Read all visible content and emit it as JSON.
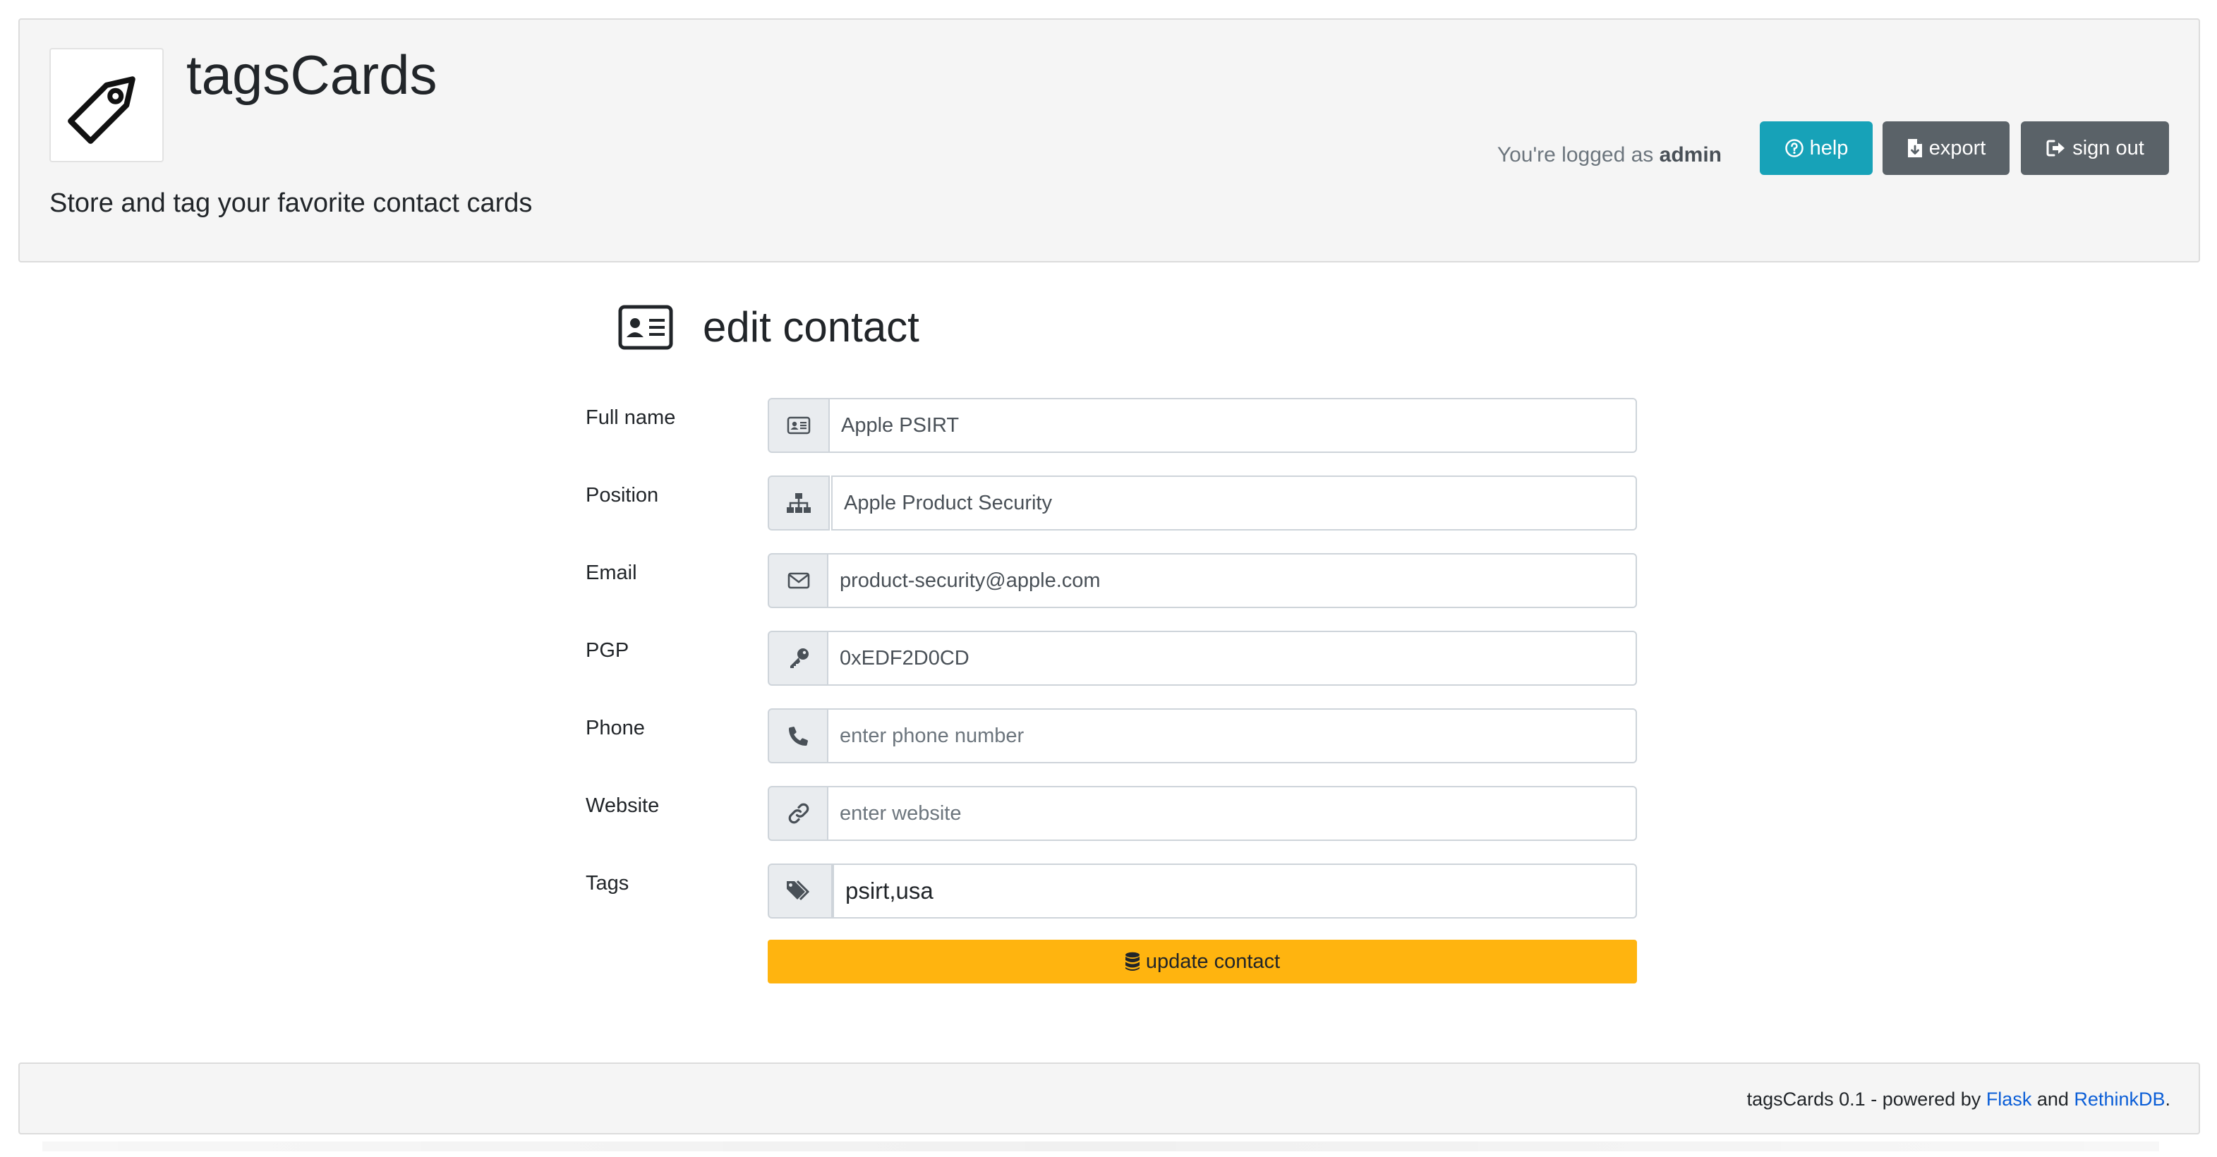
{
  "header": {
    "title": "tagsCards",
    "tagline": "Store and tag your favorite contact cards",
    "logged_prefix": "You're logged as",
    "logged_user": "admin",
    "help_label": "help",
    "export_label": "export",
    "signout_label": "sign out",
    "colors": {
      "help": "#17a2b8",
      "secondary": "#5a6268"
    }
  },
  "form": {
    "heading": "edit contact",
    "fields": [
      {
        "label": "Full name",
        "value": "Apple PSIRT",
        "placeholder": "",
        "icon": "id-card-icon"
      },
      {
        "label": "Position",
        "value": "Apple Product Security",
        "placeholder": "",
        "icon": "sitemap-icon"
      },
      {
        "label": "Email",
        "value": "product-security@apple.com",
        "placeholder": "",
        "icon": "envelope-icon"
      },
      {
        "label": "PGP",
        "value": "0xEDF2D0CD",
        "placeholder": "",
        "icon": "key-icon"
      },
      {
        "label": "Phone",
        "value": "",
        "placeholder": "enter phone number",
        "icon": "phone-icon"
      },
      {
        "label": "Website",
        "value": "",
        "placeholder": "enter website",
        "icon": "link-icon"
      },
      {
        "label": "Tags",
        "value": "psirt,usa",
        "placeholder": "",
        "icon": "tags-icon"
      }
    ],
    "submit_label": "update contact",
    "submit_color": "#ffb40f"
  },
  "footer": {
    "text_prefix": "tagsCards 0.1 - powered by",
    "link1": "Flask",
    "and": "and",
    "link2": "RethinkDB",
    "suffix": "."
  }
}
